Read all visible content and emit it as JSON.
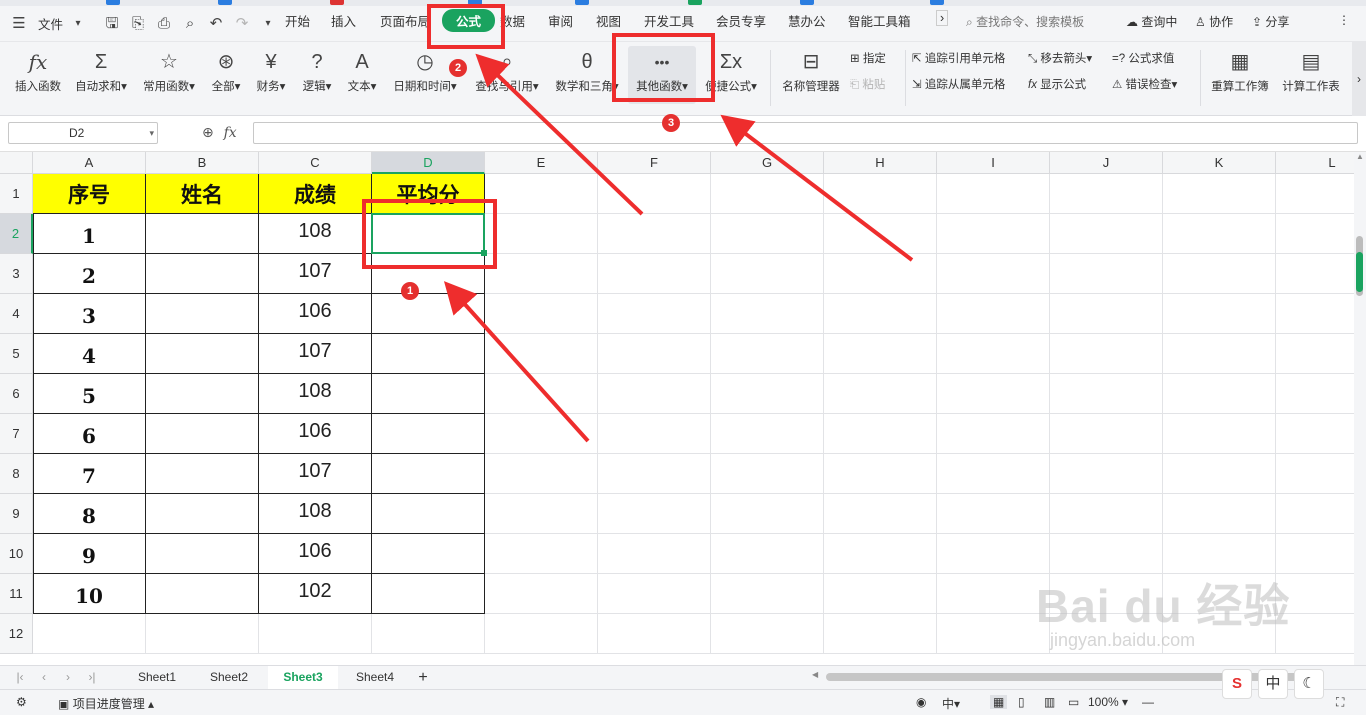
{
  "menubar": {
    "file_label": "文件",
    "tabs": [
      "开始",
      "插入",
      "页面布局",
      "公式",
      "数据",
      "审阅",
      "视图",
      "开发工具",
      "会员专享",
      "慧办公",
      "智能工具箱"
    ],
    "active_tab": "公式",
    "search_placeholder": "查找命令、搜索模板",
    "query": "查询中",
    "collab": "协作",
    "share": "分享"
  },
  "ribbon": {
    "insert_function": "插入函数",
    "autosum": "自动求和",
    "common": "常用函数",
    "all": "全部",
    "finance": "财务",
    "logic": "逻辑",
    "text": "文本",
    "datetime": "日期和时间",
    "lookup": "查找与引用",
    "math": "数学和三角",
    "other": "其他函数",
    "quick": "便捷公式",
    "name_manager": "名称管理器",
    "specify": "指定",
    "paste": "粘贴",
    "trace_prec": "追踪引用单元格",
    "trace_dep": "追踪从属单元格",
    "remove_arrows": "移去箭头",
    "show_formula": "显示公式",
    "eval_formula": "公式求值",
    "error_check": "错误检查",
    "recalc_book": "重算工作簿",
    "calc_sheet": "计算工作表"
  },
  "formula_bar": {
    "cell_ref": "D2",
    "fx": "fx",
    "value": ""
  },
  "columns": [
    "A",
    "B",
    "C",
    "D",
    "E",
    "F",
    "G",
    "H",
    "I",
    "J",
    "K",
    "L"
  ],
  "rows": [
    "1",
    "2",
    "3",
    "4",
    "5",
    "6",
    "7",
    "8",
    "9",
    "10",
    "11",
    "12"
  ],
  "table": {
    "headers": [
      "序号",
      "姓名",
      "成绩",
      "平均分"
    ],
    "seq": [
      "1",
      "2",
      "3",
      "4",
      "5",
      "6",
      "7",
      "8",
      "9",
      "10"
    ],
    "scores": [
      "108",
      "107",
      "106",
      "107",
      "108",
      "106",
      "107",
      "108",
      "106",
      "102"
    ]
  },
  "annotations": [
    "1",
    "2",
    "3"
  ],
  "sheets": [
    "Sheet1",
    "Sheet2",
    "Sheet3",
    "Sheet4"
  ],
  "active_sheet": "Sheet3",
  "status": {
    "project": "项目进度管理",
    "zoom": "100%",
    "ime": "中"
  },
  "watermark": {
    "main": "Bai du 经验",
    "sub": "jingyan.baidu.com"
  },
  "colors": {
    "accent": "#1aa35f",
    "annotation": "#ee2d2d",
    "header_fill": "#ffff00"
  }
}
